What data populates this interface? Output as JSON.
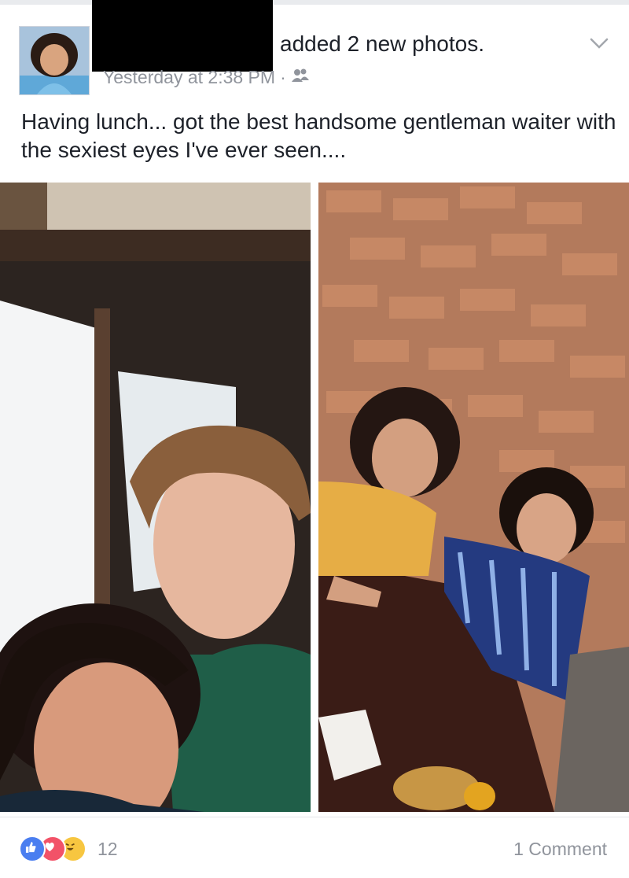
{
  "post": {
    "headline": "added 2 new photos.",
    "timestamp": "Yesterday at 2:38 PM",
    "separator": "·",
    "audience_icon": "friends-icon",
    "text": "Having lunch... got the best handsome gentleman waiter with the sexiest eyes I've ever seen...."
  },
  "reactions": {
    "icons": [
      "like-icon",
      "love-icon",
      "haha-icon"
    ],
    "count": "12"
  },
  "comments": {
    "label": "1 Comment"
  },
  "colors": {
    "text": "#1d2129",
    "meta": "#90949c",
    "like": "#4a7ef0",
    "love": "#f25268",
    "haha": "#f7c640"
  }
}
